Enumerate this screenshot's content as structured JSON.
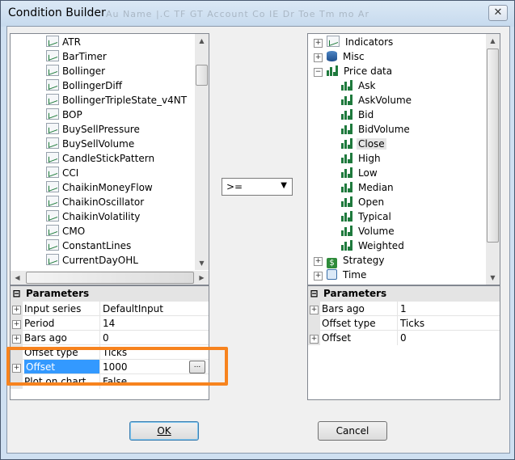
{
  "window": {
    "title": "Condition Builder",
    "ghost_text": "Au   Name   |.C  TF  GT  Account  Co  IE  Dr  Toe  Tm  mo  Ar"
  },
  "left_list": {
    "items": [
      "ATR",
      "BarTimer",
      "Bollinger",
      "BollingerDiff",
      "BollingerTripleState_v4NT",
      "BOP",
      "BuySellPressure",
      "BuySellVolume",
      "CandleStickPattern",
      "CCI",
      "ChaikinMoneyFlow",
      "ChaikinOscillator",
      "ChaikinVolatility",
      "CMO",
      "ConstantLines",
      "CurrentDayOHL"
    ]
  },
  "operator": {
    "selected": ">="
  },
  "right_tree": {
    "groups": [
      {
        "label": "Indicators",
        "expander": "+"
      },
      {
        "label": "Misc",
        "expander": "+"
      },
      {
        "label": "Price data",
        "expander": "−"
      }
    ],
    "price_items": [
      "Ask",
      "AskVolume",
      "Bid",
      "BidVolume",
      "Close",
      "High",
      "Low",
      "Median",
      "Open",
      "Typical",
      "Volume",
      "Weighted"
    ],
    "selected": "Close",
    "tail_groups": [
      {
        "label": "Strategy",
        "expander": "+"
      },
      {
        "label": "Time",
        "expander": "+"
      }
    ]
  },
  "left_params": {
    "header": "Parameters",
    "rows": [
      {
        "gutter": "+",
        "name": "Input series",
        "value": "DefaultInput"
      },
      {
        "gutter": "+",
        "name": "Period",
        "value": "14"
      },
      {
        "gutter": "+",
        "name": "Bars ago",
        "value": "0"
      },
      {
        "gutter": "",
        "name": "Offset type",
        "value": "Ticks"
      },
      {
        "gutter": "+",
        "name": "Offset",
        "value": "1000",
        "selected": true
      },
      {
        "gutter": "",
        "name": "Plot on chart",
        "value": "False"
      }
    ],
    "ellipsis": "..."
  },
  "right_params": {
    "header": "Parameters",
    "rows": [
      {
        "gutter": "+",
        "name": "Bars ago",
        "value": "1"
      },
      {
        "gutter": "",
        "name": "Offset type",
        "value": "Ticks"
      },
      {
        "gutter": "+",
        "name": "Offset",
        "value": "0"
      }
    ]
  },
  "buttons": {
    "ok": "OK",
    "cancel": "Cancel"
  },
  "colors": {
    "highlight": "#f7831e",
    "selection": "#3399ff",
    "tree_selected": "#e5e5e5"
  },
  "icons": {
    "indicator": "line-chart-icon",
    "price": "bar-chart-icon",
    "misc": "database-icon",
    "strategy": "dollar-icon",
    "time": "clock-icon"
  }
}
